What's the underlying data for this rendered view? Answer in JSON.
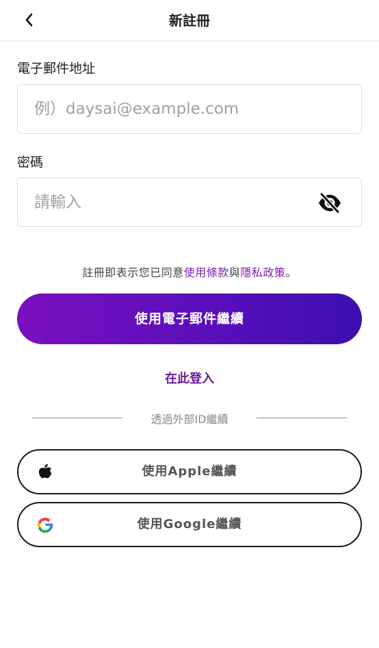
{
  "header": {
    "title": "新註冊"
  },
  "email": {
    "label": "電子郵件地址",
    "placeholder": "例）daysai@example.com",
    "value": ""
  },
  "password": {
    "label": "密碼",
    "placeholder": "請輸入",
    "value": ""
  },
  "terms": {
    "prefix": "註冊即表示您已同意",
    "terms_link": "使用條款",
    "joiner": "與",
    "privacy_link": "隱私政策",
    "suffix": "。"
  },
  "primary_button": {
    "label": "使用電子郵件繼續"
  },
  "login_link": {
    "label": "在此登入"
  },
  "divider": {
    "label": "透過外部ID繼續"
  },
  "apple_button": {
    "label": "使用Apple繼續",
    "icon": "apple-icon"
  },
  "google_button": {
    "label": "使用Google繼續",
    "icon": "google-icon"
  },
  "colors": {
    "accent": "#7a1fa8",
    "gradient_start": "#7a0fbf",
    "gradient_end": "#3c0fb0"
  }
}
